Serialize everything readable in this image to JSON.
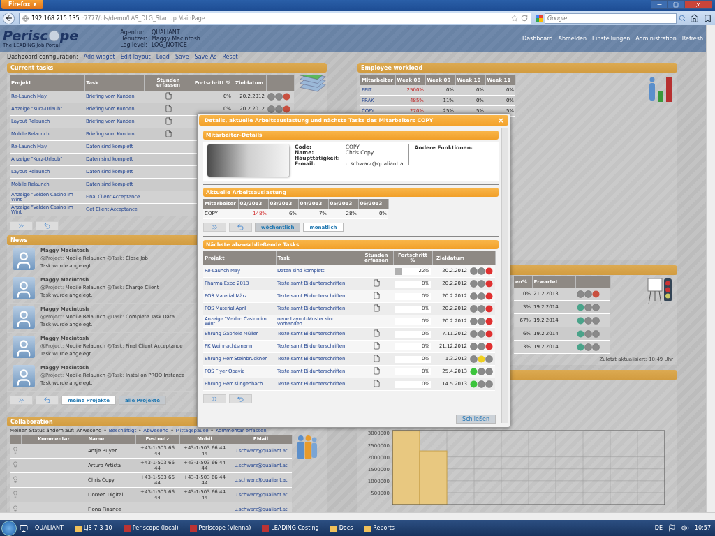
{
  "browser": {
    "app_button": "Firefox",
    "app_button_caret": "▾",
    "url_host": "192.168.215.135",
    "url_path": ":7777/pls/demo/LAS_DLG_Startup.MainPage",
    "search": {
      "placeholder": "Google"
    }
  },
  "header": {
    "logo_left": "Perisc",
    "logo_right": "pe",
    "tagline": "The LEADING Job Portal",
    "info": [
      {
        "label": "Agentur:",
        "value": "QUALIANT"
      },
      {
        "label": "Benutzer:",
        "value": "Maggy Macintosh"
      },
      {
        "label": "Log level:",
        "value": "LOG_NOTICE"
      }
    ],
    "nav": [
      "Dashboard",
      "Abmelden",
      "Einstellungen",
      "Administration",
      "Refresh"
    ]
  },
  "config": {
    "label": "Dashboard configuration:",
    "links": [
      "Add widget",
      "Edit layout",
      "Load",
      "Save",
      "Save As",
      "Reset"
    ]
  },
  "current_tasks": {
    "title": "Current tasks",
    "columns": [
      "Projekt",
      "Task",
      "Stunden erfassen",
      "Fortschritt %",
      "Zieldatum"
    ],
    "rows": [
      {
        "project": "Re-Launch May",
        "task": "Briefing vom Kunden",
        "doc": true,
        "progress": "0%",
        "date": "20.2.2012",
        "color": "#c9503f"
      },
      {
        "project": "Anzeige \"Kurz-Urlaub\"",
        "task": "Briefing vom Kunden",
        "doc": true,
        "progress": "0%",
        "date": "20.2.2012",
        "color": "#c9503f"
      },
      {
        "project": "Layout Relaunch",
        "task": "Briefing vom Kunden",
        "doc": true
      },
      {
        "project": "Mobile Relaunch",
        "task": "Briefing vom Kunden",
        "doc": true
      },
      {
        "project": "Re-Launch May",
        "task": "Daten sind komplett",
        "doc": false
      },
      {
        "project": "Anzeige \"Kurz-Urlaub\"",
        "task": "Daten sind komplett",
        "doc": false
      },
      {
        "project": "Layout Relaunch",
        "task": "Daten sind komplett",
        "doc": false
      },
      {
        "project": "Mobile Relaunch",
        "task": "Daten sind komplett",
        "doc": false
      },
      {
        "project": "Anzeige \"Velden Casino im Wint",
        "task": "Final Client Acceptance",
        "doc": false
      },
      {
        "project": "Anzeige \"Velden Casino im Wint",
        "task": "Get Client Acceptance",
        "doc": false
      }
    ]
  },
  "news": {
    "title": "News",
    "items": [
      {
        "author": "Maggy Macintosh",
        "project_label": "@Project:",
        "project": "Mobile Relaunch",
        "task_label": "@Task:",
        "task": "Close Job",
        "text": "Task wurde angelegt."
      },
      {
        "author": "Maggy Macintosh",
        "project_label": "@Project:",
        "project": "Mobile Relaunch",
        "task_label": "@Task:",
        "task": "Charge Client",
        "text": "Task wurde angelegt."
      },
      {
        "author": "Maggy Macintosh",
        "project_label": "@Project:",
        "project": "Mobile Relaunch",
        "task_label": "@Task:",
        "task": "Complete Task Data",
        "text": "Task wurde angelegt."
      },
      {
        "author": "Maggy Macintosh",
        "project_label": "@Project:",
        "project": "Mobile Relaunch",
        "task_label": "@Task:",
        "task": "Final Client Acceptance",
        "text": "Task wurde angelegt."
      },
      {
        "author": "Maggy Macintosh",
        "project_label": "@Project:",
        "project": "Mobile Relaunch",
        "task_label": "@Task:",
        "task": "Instal on PROD Instance",
        "text": "Task wurde angelegt."
      }
    ],
    "filters": [
      {
        "label": "meine Projekte",
        "selected": false
      },
      {
        "label": "alle Projekte",
        "selected": true
      }
    ]
  },
  "collaboration": {
    "title": "Collaboration",
    "status_label": "Meinen Status ändern auf:",
    "separator": "•",
    "statuses": [
      {
        "label": "Anwesend",
        "selected": true
      },
      {
        "label": "Beschäftigt",
        "selected": false
      },
      {
        "label": "Abwesend",
        "selected": false
      },
      {
        "label": "Mittagspause",
        "selected": false
      },
      {
        "label": "Kommentar erfassen",
        "selected": false
      }
    ],
    "columns": [
      "Kommentar",
      "Name",
      "Festnetz",
      "Mobil",
      "EMail"
    ],
    "rows": [
      {
        "name": "Antje Buyer",
        "phone": "+43-1-503 66 44",
        "mobile": "+43-1-503 66 44 44",
        "email": "u.schwarz@qualiant.at"
      },
      {
        "name": "Arturo Artista",
        "phone": "+43-1-503 66 44",
        "mobile": "+43-1-503 66 44 44",
        "email": "u.schwarz@qualiant.at"
      },
      {
        "name": "Chris Copy",
        "phone": "+43-1-503 66 44",
        "mobile": "+43-1-503 66 44 44",
        "email": "u.schwarz@qualiant.at"
      },
      {
        "name": "Doreen Digital",
        "phone": "+43-1-503 66 44",
        "mobile": "+43-1-503 66 44 44",
        "email": "u.schwarz@qualiant.at"
      },
      {
        "name": "Fiona Finance",
        "email": "u.schwarz@qualiant.at"
      }
    ]
  },
  "workload": {
    "title": "Employee workload",
    "columns": [
      "Mitarbeiter",
      "Week 08",
      "Week 09",
      "Week 10",
      "Week 11"
    ],
    "rows": [
      {
        "cells": [
          {
            "value": "PPIT"
          },
          {
            "value": "2500%",
            "over": true
          },
          {
            "value": "0%",
            "over": false
          },
          {
            "value": "0%",
            "over": false
          },
          {
            "value": "0%",
            "over": false
          }
        ]
      },
      {
        "cells": [
          {
            "value": "PRAK"
          },
          {
            "value": "485%",
            "over": true
          },
          {
            "value": "11%",
            "over": false
          },
          {
            "value": "0%",
            "over": false
          },
          {
            "value": "0%",
            "over": false
          }
        ]
      },
      {
        "cells": [
          {
            "value": "COPY"
          },
          {
            "value": "270%",
            "over": true
          },
          {
            "value": "25%",
            "over": false
          },
          {
            "value": "5%",
            "over": false
          },
          {
            "value": "5%",
            "over": false
          }
        ]
      }
    ]
  },
  "status_widget": {
    "columns": [
      "en%",
      "Erwartet"
    ],
    "rows": [
      {
        "percent": "0%",
        "date": "21.2.2013",
        "color": "#c9503f"
      },
      {
        "percent": "3%",
        "date": "19.2.2014",
        "color": "#4aa38a"
      },
      {
        "percent": "67%",
        "date": "19.2.2014",
        "color": "#4aa38a"
      },
      {
        "percent": "6%",
        "date": "19.2.2014",
        "color": "#4aa38a"
      },
      {
        "percent": "3%",
        "date": "19.2.2014",
        "color": "#4aa38a"
      }
    ],
    "updated": "Zuletzt aktualisiert: 10:49 Uhr"
  },
  "chart_widget": {
    "chart_data": {
      "type": "bar",
      "values": [
        3100000,
        2250000,
        null,
        null,
        null,
        null,
        null,
        null,
        null,
        null
      ],
      "ylim": [
        0,
        3100000
      ],
      "yticks": [
        500000,
        1000000,
        1500000,
        2000000,
        2500000,
        3000000
      ],
      "grid": true
    }
  },
  "modal": {
    "title": "Details, aktuelle Arbeitsauslastung und nächste Tasks des Mitarbeiters COPY",
    "close": "×",
    "details": {
      "title": "Mitarbeiter-Details",
      "fields": [
        {
          "label": "Code:",
          "value": "COPY"
        },
        {
          "label": "Name:",
          "value": "Chris Copy"
        },
        {
          "label": "Haupttätigkeit:"
        },
        {
          "label": "E-mail:",
          "value": "u.schwarz@qualiant.at"
        }
      ],
      "other_label": "Andere Funktionen:"
    },
    "workload": {
      "title": "Aktuelle Arbeitsauslastung",
      "columns": [
        "Mitarbeiter",
        "02/2013",
        "03/2013",
        "04/2013",
        "05/2013",
        "06/2013"
      ],
      "row": {
        "name": "COPY",
        "cells": [
          {
            "value": "148%",
            "over": true
          },
          {
            "value": "6%",
            "over": false
          },
          {
            "value": "7%",
            "over": false
          },
          {
            "value": "28%",
            "over": false
          },
          {
            "value": "0%",
            "over": false
          }
        ]
      },
      "modes": [
        {
          "label": "wöchentlich",
          "selected": true
        },
        {
          "label": "monatlich",
          "selected": false
        }
      ]
    },
    "tasks": {
      "title": "Nächste abzuschließende Tasks",
      "columns": [
        "Projekt",
        "Task",
        "Stunden erfassen",
        "Fortschritt %",
        "Zieldatum"
      ],
      "rows": [
        {
          "project": "Re-Launch May",
          "task": "Daten sind komplett",
          "doc": false,
          "level": 0.22,
          "progress": "22%",
          "date": "20.2.2012",
          "color": "#e03030"
        },
        {
          "project": "Pharma Expo 2013",
          "task": "Texte samt Bildunterschriften",
          "doc": true,
          "level": 0,
          "progress": "0%",
          "date": "20.2.2012",
          "color": "#e03030"
        },
        {
          "project": "POS Material März",
          "task": "Texte samt Bildunterschriften",
          "doc": true,
          "level": 0,
          "progress": "0%",
          "date": "20.2.2012",
          "color": "#e03030"
        },
        {
          "project": "POS Material April",
          "task": "Texte samt Bildunterschriften",
          "doc": true,
          "level": 0,
          "progress": "0%",
          "date": "20.2.2012",
          "color": "#e03030"
        },
        {
          "project": "Anzeige \"Velden Casino im Wint",
          "task": "neue Layout-Muster sind vorhanden",
          "doc": false,
          "level": 0,
          "progress": "0%",
          "date": "20.2.2012",
          "color": "#e03030"
        },
        {
          "project": "Ehrung Gabriele Müller",
          "task": "Texte samt Bildunterschriften",
          "doc": true,
          "level": 0,
          "progress": "0%",
          "date": "7.11.2012",
          "color": "#e03030"
        },
        {
          "project": "PK Weihnachtsmann",
          "task": "Texte samt Bildunterschriften",
          "doc": true,
          "level": 0,
          "progress": "0%",
          "date": "21.12.2012",
          "color": "#e03030"
        },
        {
          "project": "Ehrung Herr Steinbruckner",
          "task": "Texte samt Bildunterschriften",
          "doc": true,
          "level": 0,
          "progress": "0%",
          "date": "1.3.2013",
          "color": "#f0d020"
        },
        {
          "project": "POS Flyer Opavia",
          "task": "Texte samt Bildunterschriften",
          "doc": true,
          "level": 0,
          "progress": "0%",
          "date": "25.4.2013",
          "color": "#3cc43c"
        },
        {
          "project": "Ehrung Herr Klingenbach",
          "task": "Texte samt Bildunterschriften",
          "doc": true,
          "level": 0,
          "progress": "0%",
          "date": "14.5.2013",
          "color": "#3cc43c"
        }
      ]
    },
    "close_button": "Schließen"
  },
  "taskbar": {
    "items": [
      {
        "label": "QUALIANT",
        "kind": "plain"
      },
      {
        "label": "LJS-7-3-10",
        "kind": "folder"
      },
      {
        "label": "Periscope (local)",
        "kind": "app"
      },
      {
        "label": "Periscope (Vienna)",
        "kind": "app"
      },
      {
        "label": "LEADING Costing",
        "kind": "app"
      },
      {
        "label": "Docs",
        "kind": "folder"
      },
      {
        "label": "Reports",
        "kind": "folder"
      }
    ],
    "language": "DE",
    "clock": "10:57"
  }
}
